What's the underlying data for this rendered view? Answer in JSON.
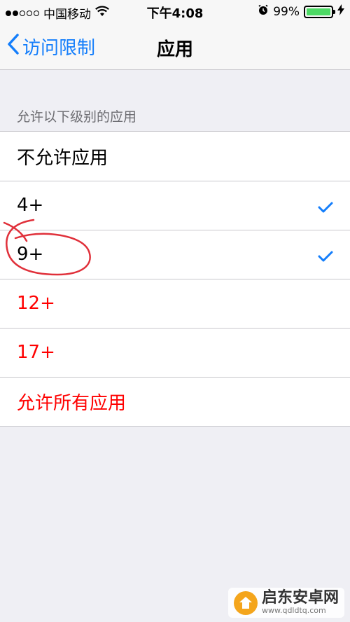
{
  "status_bar": {
    "carrier": "中国移动",
    "time": "下午4:08",
    "battery": "99%",
    "battery_level": 0.99,
    "signal_strength": 2,
    "signal_max": 5
  },
  "nav": {
    "back_label": "访问限制",
    "title": "应用"
  },
  "section": {
    "header": "允许以下级别的应用"
  },
  "rows": [
    {
      "label": "不允许应用",
      "checked": false,
      "color": "#000000"
    },
    {
      "label": "4+",
      "checked": true,
      "color": "#000000"
    },
    {
      "label": "9+",
      "checked": true,
      "color": "#000000"
    },
    {
      "label": "12+",
      "checked": false,
      "color": "#ff0000"
    },
    {
      "label": "17+",
      "checked": false,
      "color": "#ff0000"
    },
    {
      "label": "允许所有应用",
      "checked": false,
      "color": "#ff0000"
    }
  ],
  "colors": {
    "accent": "#147efb",
    "restricted": "#ff0000",
    "annotation": "#e0303a"
  },
  "watermark": {
    "brand": "启东安卓网",
    "url": "www.qdldtq.com"
  }
}
